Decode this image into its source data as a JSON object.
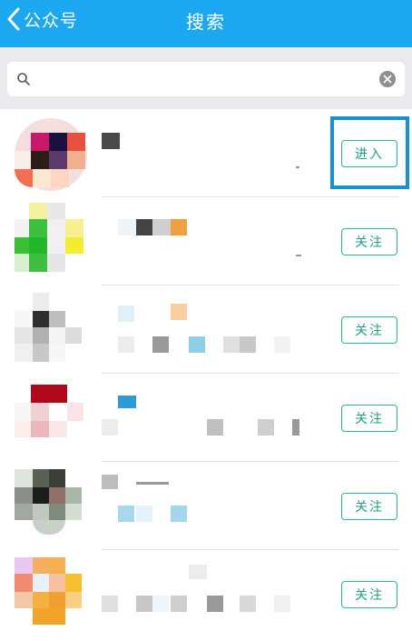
{
  "header": {
    "back_label": "公众号",
    "title": "搜索"
  },
  "search": {
    "value": "",
    "placeholder": ""
  },
  "results": [
    {
      "button_label": "进入"
    },
    {
      "button_label": "关注"
    },
    {
      "button_label": "关注"
    },
    {
      "button_label": "关注"
    },
    {
      "button_label": "关注"
    },
    {
      "button_label": "关注"
    }
  ],
  "colors": {
    "header_bg": "#1ba8f0",
    "search_area_bg": "#e9e9ee",
    "button_border": "#26b6a0",
    "highlight_border": "#1890d8"
  },
  "icons": {
    "back": "chevron-left-icon",
    "search": "search-icon",
    "clear": "clear-icon"
  }
}
